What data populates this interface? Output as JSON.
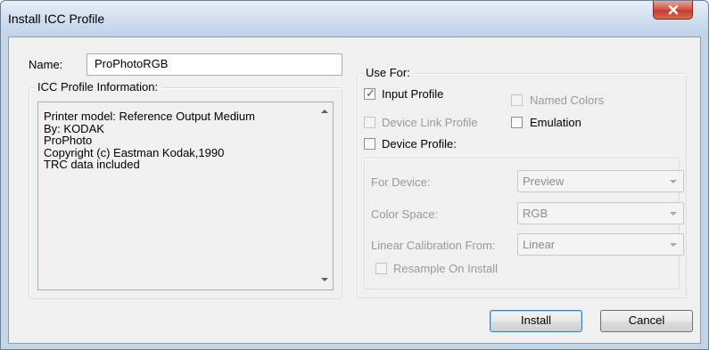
{
  "window": {
    "title": "Install ICC Profile"
  },
  "name_field": {
    "label": "Name:",
    "value": "ProPhotoRGB"
  },
  "profile_info": {
    "caption": "ICC Profile Information:",
    "lines": [
      "Printer model: Reference Output Medium",
      "By: KODAK",
      "ProPhoto",
      "Copyright (c) Eastman Kodak,1990",
      "TRC data included"
    ]
  },
  "use_for": {
    "caption": "Use For:",
    "input_profile": {
      "label": "Input Profile",
      "checked": true,
      "enabled": true
    },
    "named_colors": {
      "label": "Named Colors",
      "checked": false,
      "enabled": false
    },
    "device_link_profile": {
      "label": "Device Link Profile",
      "checked": false,
      "enabled": false
    },
    "emulation": {
      "label": "Emulation",
      "checked": false,
      "enabled": true
    },
    "device_profile": {
      "label": "Device Profile:",
      "checked": false,
      "enabled": true
    }
  },
  "device_settings": {
    "for_device": {
      "label": "For Device:",
      "value": "Preview"
    },
    "color_space": {
      "label": "Color Space:",
      "value": "RGB"
    },
    "linear_calibration": {
      "label": "Linear Calibration From:",
      "value": "Linear"
    },
    "resample": {
      "label": "Resample On Install",
      "checked": false
    }
  },
  "buttons": {
    "install": "Install",
    "cancel": "Cancel"
  },
  "colors": {
    "title_bar": "#cddcee",
    "close_button": "#c53c2b",
    "dialog_bg": "#f0f0f0",
    "check_mark": "#2f5ea8"
  }
}
